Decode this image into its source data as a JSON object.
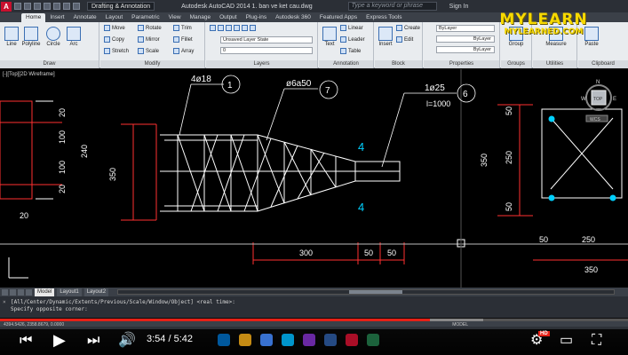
{
  "titlebar": {
    "logo": "A",
    "workspace": "Drafting & Annotation",
    "title": "Autodesk AutoCAD 2014   1. ban ve ket cau.dwg",
    "search_placeholder": "Type a keyword or phrase",
    "signin": "Sign In"
  },
  "ribbon_tabs": [
    "Home",
    "Insert",
    "Annotate",
    "Layout",
    "Parametric",
    "View",
    "Manage",
    "Output",
    "Plug-ins",
    "Autodesk 360",
    "Featured Apps",
    "Express Tools"
  ],
  "panels": {
    "draw": {
      "footer": "Draw",
      "line": "Line",
      "polyline": "Polyline",
      "circle": "Circle",
      "arc": "Arc"
    },
    "modify": {
      "footer": "Modify",
      "move": "Move",
      "rotate": "Rotate",
      "trim": "Trim",
      "copy": "Copy",
      "mirror": "Mirror",
      "fillet": "Fillet",
      "stretch": "Stretch",
      "scale": "Scale",
      "array": "Array"
    },
    "layers": {
      "footer": "Layers",
      "state": "Unsaved Layer State",
      "current": "0"
    },
    "annotation": {
      "footer": "Annotation",
      "text": "Text",
      "linear": "Linear",
      "leader": "Leader",
      "table": "Table"
    },
    "block": {
      "footer": "Block",
      "insert": "Insert",
      "create": "Create",
      "edit": "Edit"
    },
    "properties": {
      "footer": "Properties",
      "color": "ByLayer",
      "linetype": "ByLayer",
      "lineweight": "ByLayer"
    },
    "groups": {
      "footer": "Groups",
      "group": "Group"
    },
    "utilities": {
      "footer": "Utilities",
      "measure": "Measure"
    },
    "clipboard": {
      "footer": "Clipboard",
      "paste": "Paste"
    }
  },
  "brand": {
    "line1": "MYLEARN",
    "line2": "MYLEARNED.COM"
  },
  "viewport_label": "[-][Top][2D Wireframe]",
  "viewcube": {
    "n": "N",
    "w": "W",
    "e": "E",
    "top": "TOP",
    "wcs": "WCS"
  },
  "drawing": {
    "labels": {
      "bar1": "4ø18",
      "bar1_no": "1",
      "bar2": "ø6a50",
      "bar2_no": "7",
      "bar3": "1ø25",
      "bar3_len": "l=1000",
      "bar3_no": "6",
      "four_top": "4",
      "four_bottom": "4",
      "d50a": "50",
      "d250a": "250",
      "d50b": "50",
      "d350a": "350",
      "d20a": "20",
      "d100a": "100",
      "d100b": "100",
      "d20b": "20",
      "d240": "240",
      "d20c": "20",
      "d350b": "350",
      "d300": "300",
      "d50c": "50",
      "d50d": "50",
      "d50e": "50",
      "d250b": "250",
      "d350c": "350"
    }
  },
  "layout_tabs": [
    "Model",
    "Layout1",
    "Layout2"
  ],
  "command": {
    "line1": "[All/Center/Dynamic/Extents/Previous/Scale/Window/Object] <real time>:",
    "line2": "Specify opposite corner:"
  },
  "status": {
    "coords": "4394.5426, 2358.8679, 0.0000",
    "model": "MODEL"
  },
  "player": {
    "current": "3:54",
    "duration": "5:42",
    "separator": " / ",
    "progress": 0.684,
    "hd": "HD"
  },
  "colors": {
    "accent_red": "#e62117",
    "cad_white": "#ffffff",
    "cad_cyan": "#00d0ff",
    "cad_red": "#ff3030",
    "brand_yellow": "#f7d900"
  }
}
